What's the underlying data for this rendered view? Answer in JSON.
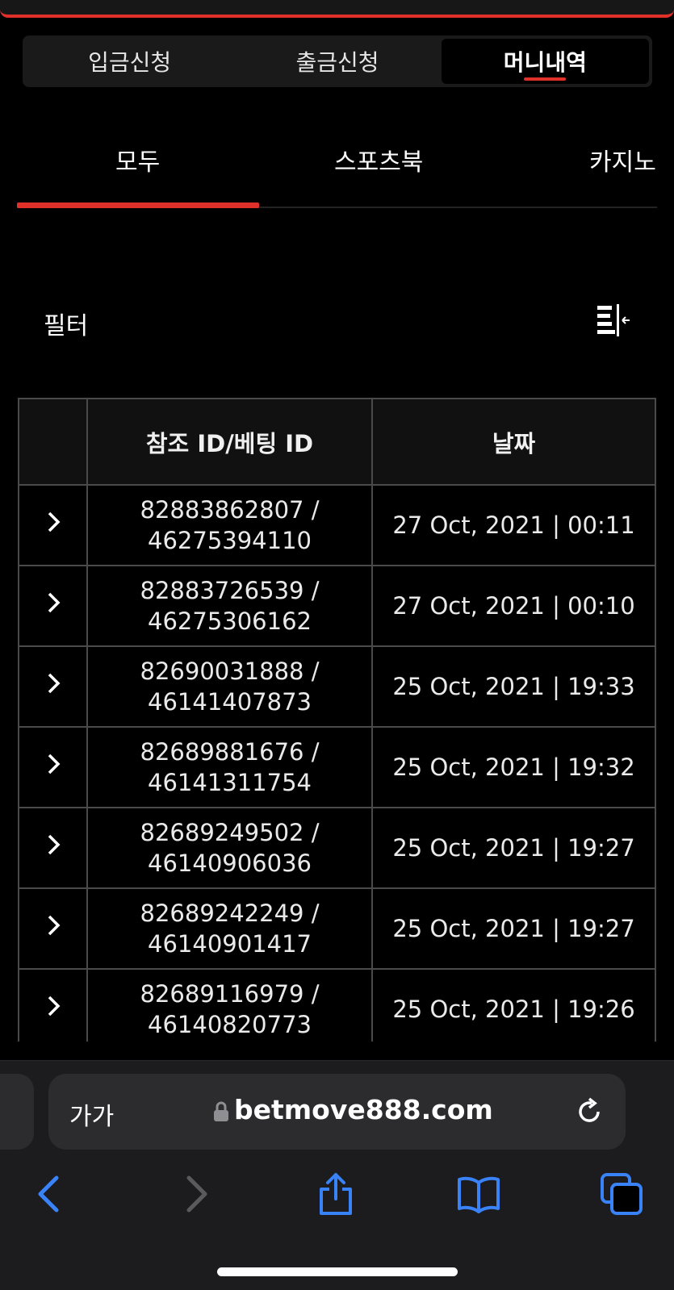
{
  "segmented_tabs": [
    "입금신청",
    "출금신청",
    "머니내역"
  ],
  "active_segment": "머니내역",
  "sub_tabs": [
    "모두",
    "스포츠북",
    "카지노"
  ],
  "active_sub_tab": "모두",
  "filter": {
    "label": "필터",
    "icon": "filter-collapse-icon"
  },
  "table": {
    "headers": [
      "",
      "참조 ID/베팅 ID",
      "날짜"
    ],
    "rows": [
      {
        "ref_id": "82883862807 /",
        "bet_id": "46275394110",
        "date": "27 Oct, 2021 | 00:11"
      },
      {
        "ref_id": "82883726539 /",
        "bet_id": "46275306162",
        "date": "27 Oct, 2021 | 00:10"
      },
      {
        "ref_id": "82690031888 /",
        "bet_id": "46141407873",
        "date": "25 Oct, 2021 | 19:33"
      },
      {
        "ref_id": "82689881676 /",
        "bet_id": "46141311754",
        "date": "25 Oct, 2021 | 19:32"
      },
      {
        "ref_id": "82689249502 /",
        "bet_id": "46140906036",
        "date": "25 Oct, 2021 | 19:27"
      },
      {
        "ref_id": "82689242249 /",
        "bet_id": "46140901417",
        "date": "25 Oct, 2021 | 19:27"
      },
      {
        "ref_id": "82689116979 /",
        "bet_id": "46140820773",
        "date": "25 Oct, 2021 | 19:26"
      }
    ]
  },
  "browser": {
    "text_size_button": "가가",
    "url": "betmove888.com",
    "icons": [
      "back-icon",
      "forward-icon",
      "share-icon",
      "bookmarks-icon",
      "tabs-icon"
    ]
  },
  "colors": {
    "accent": "#e0302a",
    "ios_blue": "#3a82f7",
    "disabled": "#5a5a5e"
  }
}
